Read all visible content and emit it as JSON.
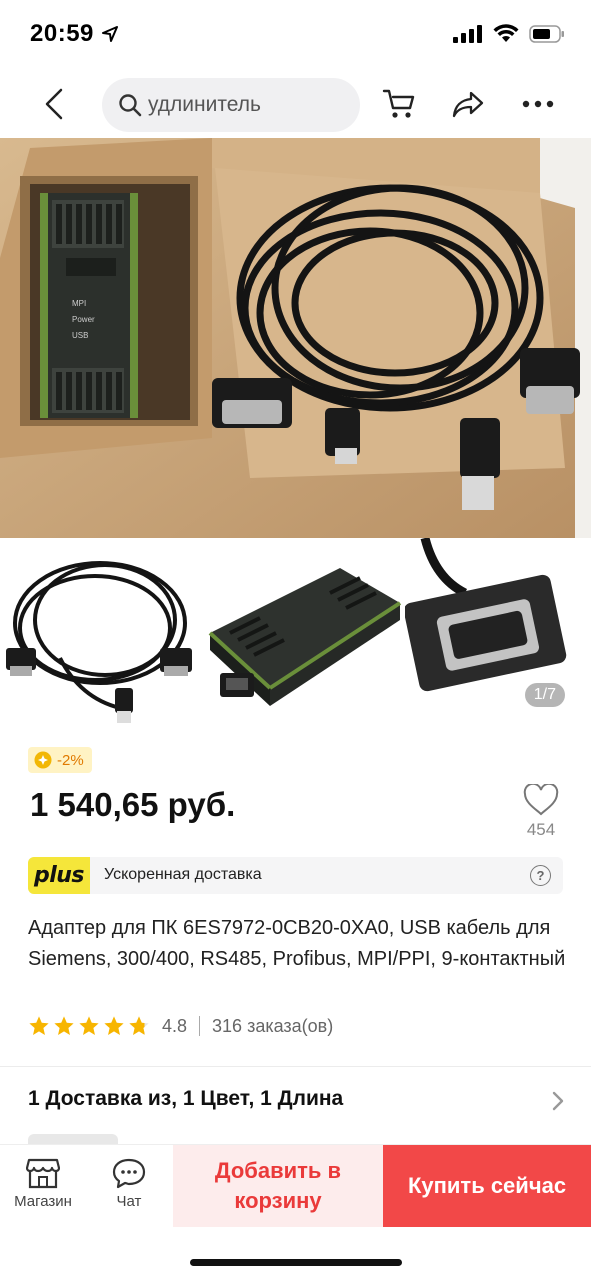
{
  "status_bar": {
    "time": "20:59"
  },
  "header": {
    "search_text": "удлинитель",
    "icons": [
      "back-icon",
      "search-icon",
      "cart-icon",
      "share-icon",
      "more-icon"
    ]
  },
  "gallery": {
    "page_indicator": "1/7"
  },
  "product": {
    "discount_label": "-2%",
    "price": "1 540,65 руб.",
    "favorites_count": "454",
    "plus_logo": "plus",
    "plus_text": "Ускоренная доставка",
    "help_icon": "?",
    "title": "Адаптер для ПК 6ES7972-0CB20-0XA0, USB кабель для Siemens, 300/400, RS485, Profibus, MPI/PPI, 9-контактный",
    "rating": "4.8",
    "rating_stars": 4.8,
    "orders": "316 заказа(ов)",
    "options": "1 Доставка из, 1 Цвет, 1 Длина"
  },
  "photo_text": {
    "mpi": "MPI",
    "power": "Power",
    "usb": "USB"
  },
  "bottom_bar": {
    "store_label": "Магазин",
    "chat_label": "Чат",
    "add_to_cart": "Добавить в корзину",
    "buy_now": "Купить сейчас"
  },
  "colors": {
    "accent_red": "#f24848",
    "cart_bg": "#fdecec",
    "plus_yellow": "#f5e63a",
    "star": "#f7b500"
  }
}
